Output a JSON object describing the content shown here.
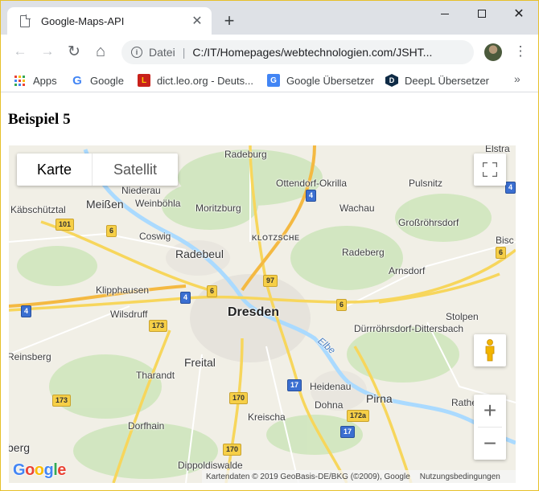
{
  "browser": {
    "tab_title": "Google-Maps-API",
    "tab_close": "✕",
    "new_tab": "+",
    "close_glyph": "✕",
    "omnibox": {
      "info": "i",
      "security_label": "Datei",
      "separator": "|",
      "url": "C:/IT/Homepages/webtechnologien.com/JSHT..."
    },
    "icons": {
      "back": "←",
      "forward": "→",
      "reload": "↻",
      "home": "⌂",
      "star": "☆",
      "menu": "⋮"
    },
    "bookmarks": [
      {
        "label": "Apps",
        "icon": "apps-icon"
      },
      {
        "label": "Google",
        "icon": "google-icon",
        "glyph": "G"
      },
      {
        "label": "dict.leo.org - Deuts...",
        "icon": "leo-icon",
        "glyph": "L"
      },
      {
        "label": "Google Übersetzer",
        "icon": "google-translate-icon",
        "glyph": "G"
      },
      {
        "label": "DeepL Übersetzer",
        "icon": "deepl-icon",
        "glyph": "D"
      }
    ],
    "bookmarks_more": "»"
  },
  "page": {
    "heading": "Beispiel 5"
  },
  "map": {
    "map_type": {
      "karte": "Karte",
      "satellit": "Satellit"
    },
    "zoom_in": "+",
    "zoom_out": "−",
    "google_logo": {
      "g1": "G",
      "o1": "o",
      "o2": "o",
      "g2": "g",
      "l": "l",
      "e": "e"
    },
    "attribution": "Kartendaten © 2019 GeoBasis-DE/BKG (©2009), Google",
    "terms": "Nutzungsbedingungen",
    "places": {
      "radeburg": "Radeburg",
      "ottendorf": "Ottendorf-Okrilla",
      "pulsnitz": "Pulsnitz",
      "elstra": "Elstra",
      "niederau": "Niederau",
      "meissen": "Meißen",
      "weinboehla": "Weinböhla",
      "kaebschuetztal": "Käbschütztal",
      "moritzburg": "Moritzburg",
      "wachau": "Wachau",
      "grossroehrsdorf": "Großröhrsdorf",
      "coswig": "Coswig",
      "klotzsche": "KLOTZSCHE",
      "bisch": "Bisc",
      "radebeul": "Radebeul",
      "radeberg": "Radeberg",
      "arnsdorf": "Arnsdorf",
      "klipphausen": "Klipphausen",
      "wilsdruff": "Wilsdruff",
      "dresden": "Dresden",
      "stolpen": "Stolpen",
      "duerrroehrsdorf": "Dürrröhrsdorf-Dittersbach",
      "elbe": "Elbe",
      "reinsberg": "Reinsberg",
      "freital": "Freital",
      "tharandt": "Tharandt",
      "heidenau": "Heidenau",
      "pirna": "Pirna",
      "rathen": "Rathe",
      "dohna": "Dohna",
      "kreischa": "Kreischa",
      "dorfhain": "Dorfhain",
      "berg": "berg",
      "dippoldiswalde": "Dippoldiswalde"
    },
    "shields": {
      "a4_top": "4",
      "a4_left": "4",
      "a4_mid": "4",
      "a4_right": "4",
      "b101": "101",
      "b6_w": "6",
      "b6_c": "6",
      "b6_e": "6",
      "b6_ne": "6",
      "b97": "97",
      "b173_c": "173",
      "b173_w": "173",
      "a17_c": "17",
      "a17_s": "17",
      "b170_a": "170",
      "b170_b": "170",
      "b172a": "172a"
    }
  }
}
